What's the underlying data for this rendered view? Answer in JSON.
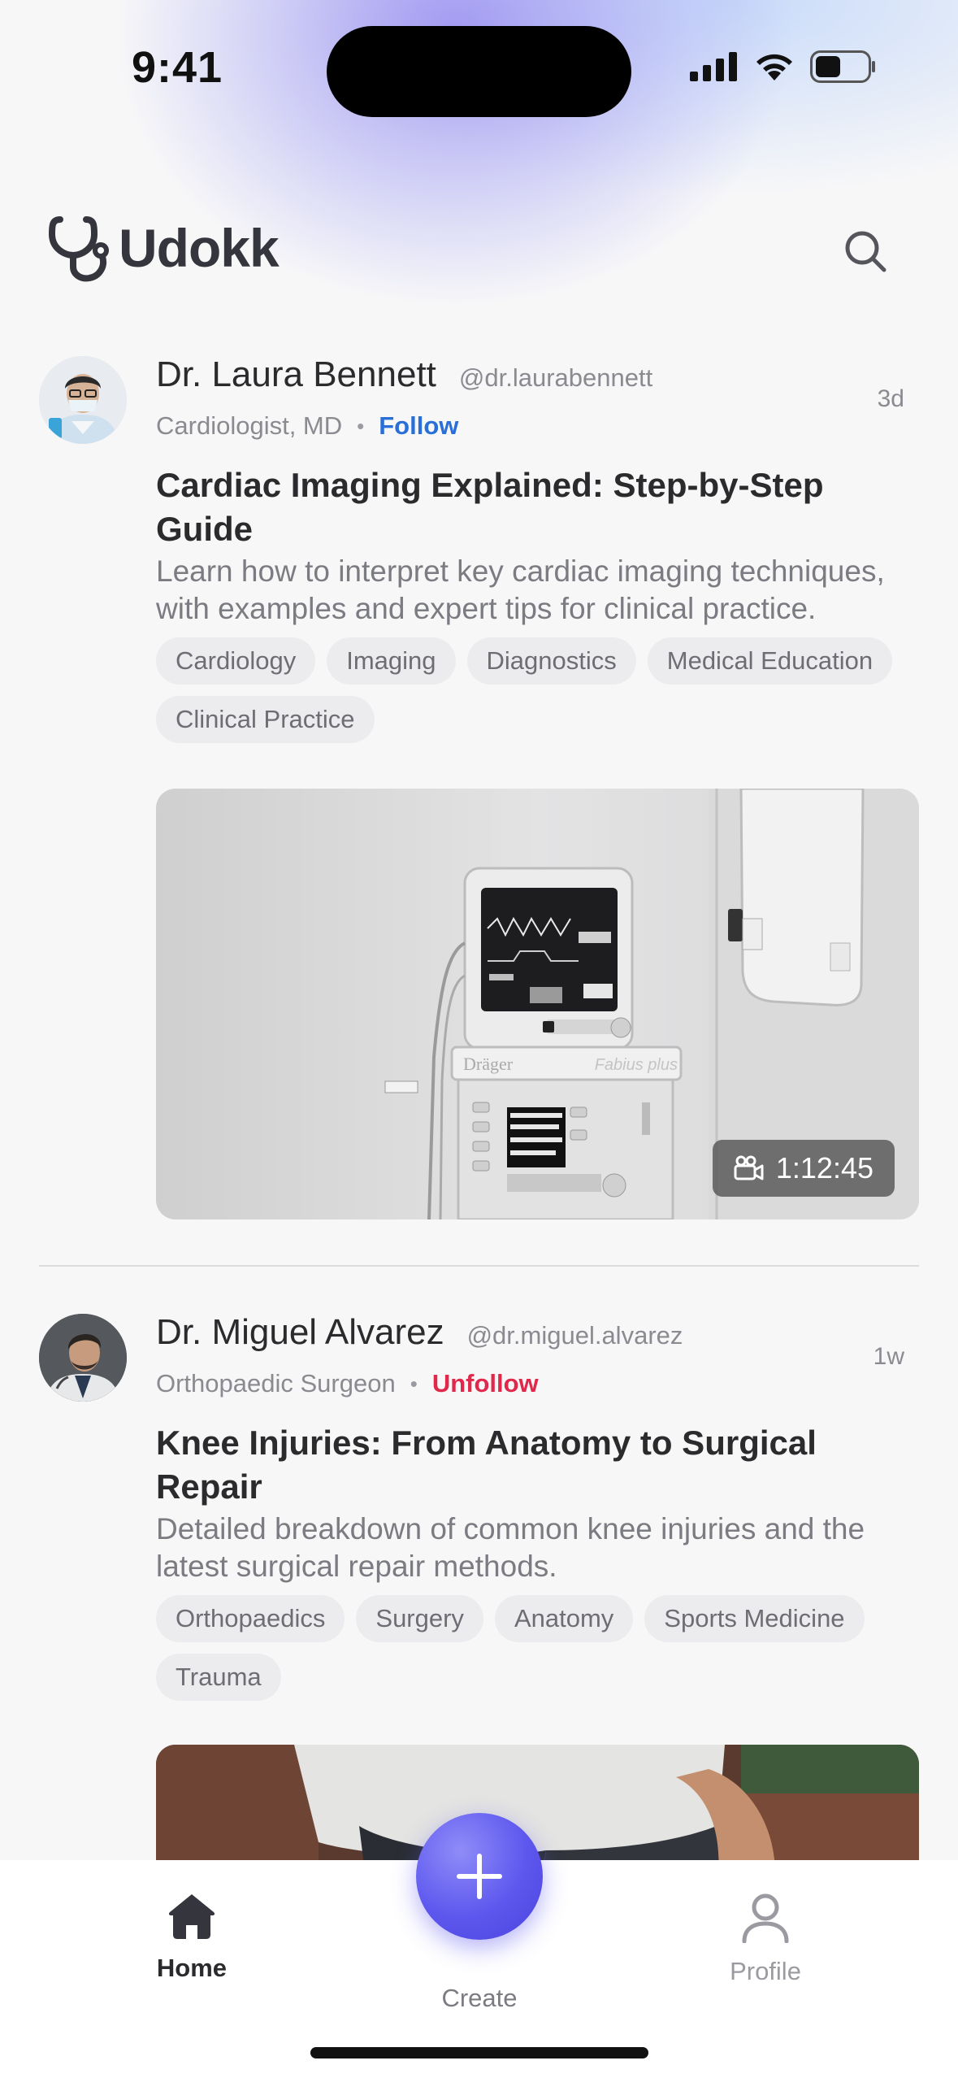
{
  "status_bar": {
    "time": "9:41"
  },
  "header": {
    "app_name": "Udokk"
  },
  "posts": [
    {
      "author_name": "Dr. Laura Bennett",
      "handle": "@dr.laurabennett",
      "role": "Cardiologist, MD",
      "follow_label": "Follow",
      "age": "3d",
      "title": "Cardiac Imaging Explained: Step-by-Step Guide",
      "description": "Learn how to interpret key cardiac imaging techniques, with examples and expert tips for clinical practice.",
      "tags": [
        "Cardiology",
        "Imaging",
        "Diagnostics",
        "Medical Education",
        "Clinical Practice"
      ],
      "media": {
        "duration": "1:12:45",
        "monitor_brand": "Dräger",
        "device_name": "Fabius plus"
      }
    },
    {
      "author_name": "Dr. Miguel Alvarez",
      "handle": "@dr.miguel.alvarez",
      "role": "Orthopaedic Surgeon",
      "follow_label": "Unfollow",
      "age": "1w",
      "title": "Knee Injuries: From Anatomy to Surgical Repair",
      "description": "Detailed breakdown of common knee injuries and the latest surgical repair methods.",
      "tags": [
        "Orthopaedics",
        "Surgery",
        "Anatomy",
        "Sports Medicine",
        "Trauma"
      ]
    }
  ],
  "tab_bar": {
    "home": "Home",
    "create": "Create",
    "profile": "Profile"
  },
  "colors": {
    "accent": "#5d57ee",
    "follow": "#2a6fd8",
    "unfollow": "#e0284b"
  }
}
